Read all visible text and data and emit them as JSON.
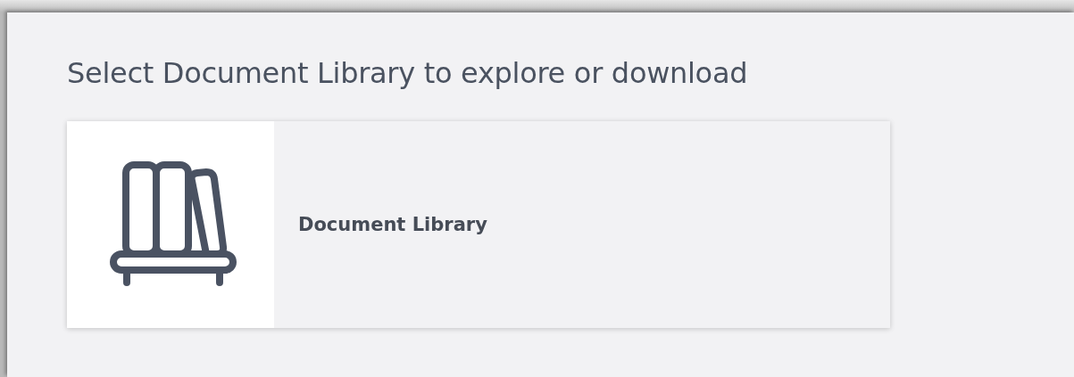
{
  "heading": "Select Document Library to explore or download",
  "libraries": [
    {
      "name": "Document Library"
    }
  ]
}
